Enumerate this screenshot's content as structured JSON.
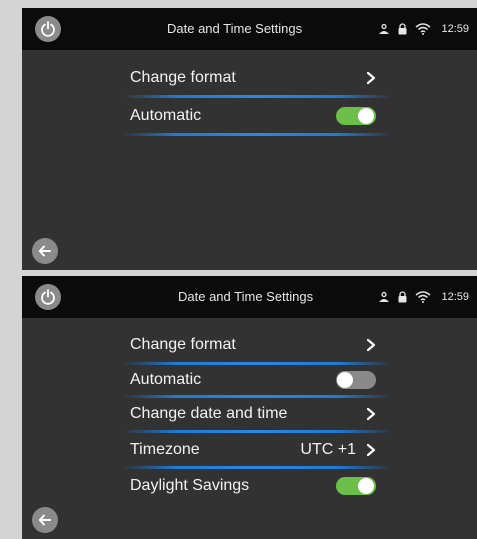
{
  "screens": [
    {
      "header": {
        "title": "Date and Time Settings",
        "time": "12:59"
      },
      "items": [
        {
          "label": "Change format",
          "kind": "nav"
        },
        {
          "label": "Automatic",
          "kind": "toggle",
          "state": "on"
        }
      ]
    },
    {
      "header": {
        "title": "Date and Time Settings",
        "time": "12:59"
      },
      "items": [
        {
          "label": "Change format",
          "kind": "nav"
        },
        {
          "label": "Automatic",
          "kind": "toggle",
          "state": "off"
        },
        {
          "label": "Change date and time",
          "kind": "nav"
        },
        {
          "label": "Timezone",
          "value": "UTC +1",
          "kind": "nav"
        },
        {
          "label": "Daylight Savings",
          "kind": "toggle",
          "state": "on"
        }
      ]
    }
  ],
  "colors": {
    "toggle_on": "#6cc04a",
    "toggle_off": "#8a8a8a",
    "divider_accent": "#2a86e8",
    "screen_bg": "#323232",
    "statusbar_bg": "#0b0b0b"
  },
  "icons": [
    "power-icon",
    "user-icon",
    "lock-icon",
    "wifi-icon",
    "chevron-right-icon",
    "back-arrow-icon"
  ]
}
